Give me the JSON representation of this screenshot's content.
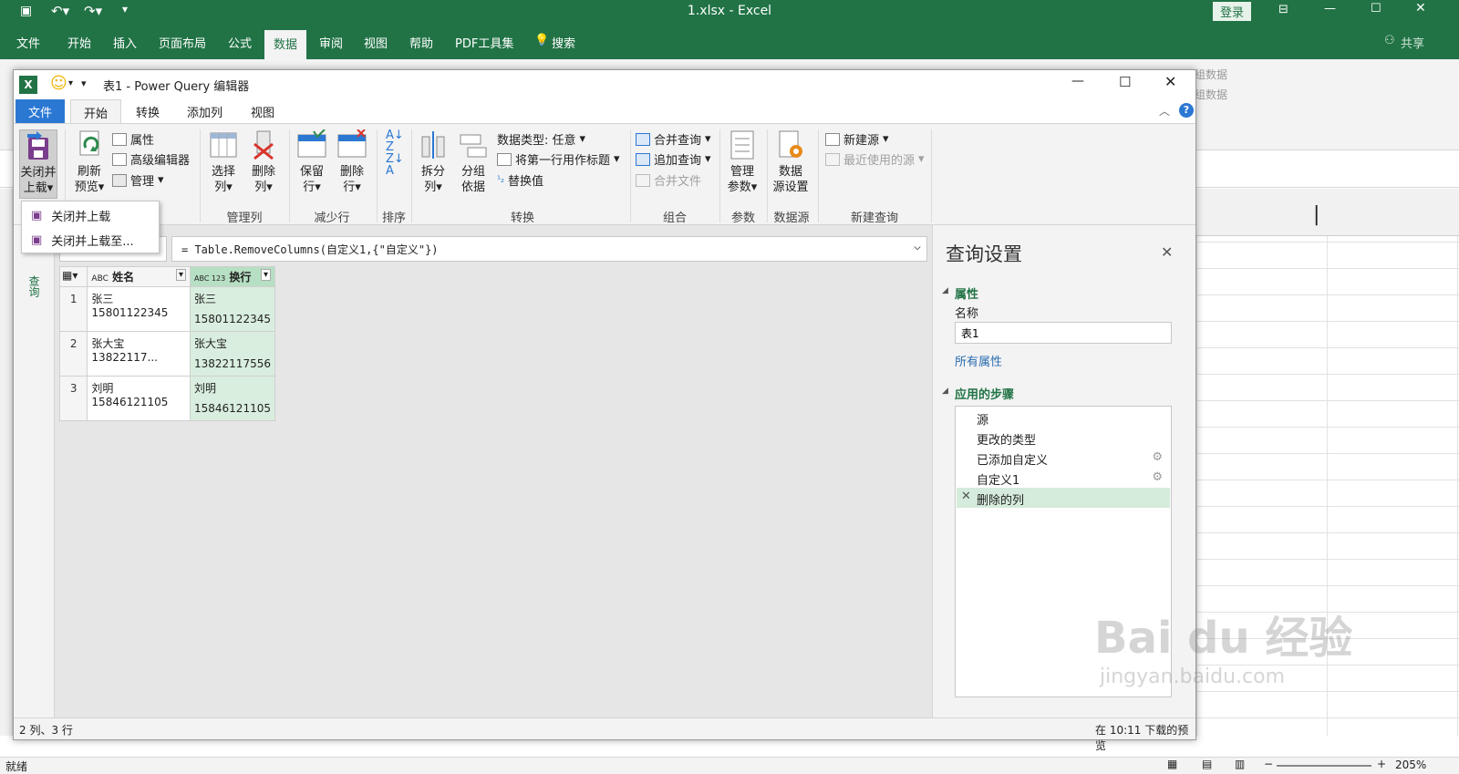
{
  "excel": {
    "title": "1.xlsx  -  Excel",
    "login_label": "登录",
    "share_label": "共享",
    "tabs": [
      "文件",
      "开始",
      "插入",
      "页面布局",
      "公式",
      "数据",
      "审阅",
      "视图",
      "帮助",
      "PDF工具集"
    ],
    "active_tab": "数据",
    "search_label": "搜索",
    "ribbon_right": [
      "组数据",
      "组数据"
    ],
    "status_left": "就绪",
    "zoom": "205%"
  },
  "pq": {
    "title": "表1 - Power Query 编辑器",
    "tabs": [
      "文件",
      "开始",
      "转换",
      "添加列",
      "视图"
    ],
    "active_tab": "开始",
    "ribbon": {
      "close_load": "关闭并\n上载",
      "close_load_line1": "关闭并",
      "close_load_line2": "上载",
      "refresh_line1": "刷新",
      "refresh_line2": "预览",
      "properties": "属性",
      "advanced_editor": "高级编辑器",
      "manage": "管理",
      "choose_cols_line1": "选择",
      "choose_cols_line2": "列",
      "remove_cols_line1": "删除",
      "remove_cols_line2": "列",
      "keep_rows_line1": "保留",
      "keep_rows_line2": "行",
      "remove_rows_line1": "删除",
      "remove_rows_line2": "行",
      "split_line1": "拆分",
      "split_line2": "列",
      "group_line1": "分组",
      "group_line2": "依据",
      "data_type": "数据类型: 任意",
      "first_row_header": "将第一行用作标题",
      "replace_values": "替换值",
      "merge_queries": "合并查询",
      "append_queries": "追加查询",
      "combine_files": "合并文件",
      "manage_params_line1": "管理",
      "manage_params_line2": "参数",
      "ds_settings_line1": "数据",
      "ds_settings_line2": "源设置",
      "new_source": "新建源",
      "recent_sources": "最近使用的源",
      "groups": {
        "manage_cols": "管理列",
        "reduce_rows": "减少行",
        "sort": "排序",
        "transform": "转换",
        "combine": "组合",
        "params": "参数",
        "datasource": "数据源",
        "new_query": "新建查询"
      }
    },
    "dropdown": [
      "关闭并上载",
      "关闭并上载至..."
    ],
    "left_pane_label": "查询",
    "formula": "= Table.RemoveColumns(自定义1,{\"自定义\"})",
    "columns": [
      {
        "type": "ABC",
        "name": "姓名"
      },
      {
        "type": "ABC 123",
        "name": "换行"
      }
    ],
    "rows": [
      {
        "n": "1",
        "c1": "张三15801122345",
        "c2a": "张三",
        "c2b": "15801122345"
      },
      {
        "n": "2",
        "c1": "张大宝13822117...",
        "c2a": "张大宝",
        "c2b": "13822117556"
      },
      {
        "n": "3",
        "c1": "刘明15846121105",
        "c2a": "刘明",
        "c2b": "15846121105"
      }
    ],
    "status_left": "2 列、3 行",
    "status_right": "在 10:11 下载的预览",
    "settings": {
      "title": "查询设置",
      "properties_label": "属性",
      "name_label": "名称",
      "name_value": "表1",
      "all_props": "所有属性",
      "steps_label": "应用的步骤",
      "steps": [
        "源",
        "更改的类型",
        "已添加自定义",
        "自定义1",
        "删除的列"
      ]
    }
  },
  "watermark": {
    "text": "Bai du 经验",
    "url": "jingyan.baidu.com"
  },
  "colors": {
    "excel_green": "#217346",
    "pq_blue": "#2b78d3",
    "selected_green": "#d5ebdb"
  }
}
